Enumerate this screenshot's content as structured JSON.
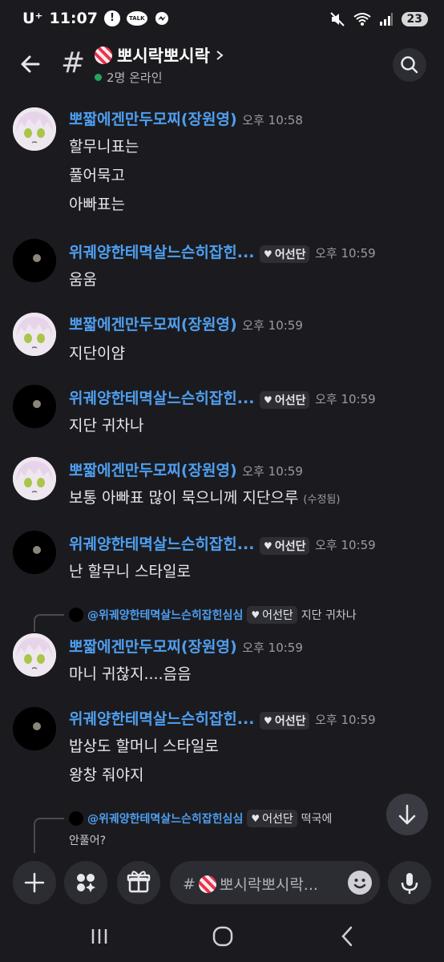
{
  "status": {
    "carrier": "U⁺",
    "time": "11:07",
    "battery": "23"
  },
  "channel": {
    "title": "뽀시락뽀시락",
    "online": "2명 온라인",
    "input_placeholder": "뽀시락뽀시락..."
  },
  "messages": [
    {
      "user": "뽀짧에겐만두모찌(장원영)",
      "time": "오후 10:58",
      "lines": [
        "할무니표는",
        "풀어묵고",
        "아빠표는"
      ]
    },
    {
      "user": "위궤양한테멱살느슨히잡힌...",
      "tag": "어선단",
      "time": "오후 10:59",
      "lines": [
        "움움"
      ]
    },
    {
      "user": "뽀짧에겐만두모찌(장원영)",
      "time": "오후 10:59",
      "lines": [
        "지단이얌"
      ]
    },
    {
      "user": "위궤양한테멱살느슨히잡힌...",
      "tag": "어선단",
      "time": "오후 10:59",
      "lines": [
        "지단 귀차나"
      ]
    },
    {
      "user": "뽀짧에겐만두모찌(장원영)",
      "time": "오후 10:59",
      "lines": [
        "보통 아빠표 많이 묵으니께 지단으루"
      ],
      "edited": "(수정됨)"
    },
    {
      "user": "위궤양한테멱살느슨히잡힌...",
      "tag": "어선단",
      "time": "오후 10:59",
      "lines": [
        "난 할무니 스타일로"
      ]
    },
    {
      "reply": {
        "name": "@위궤양한테멱살느슨히잡힌심심",
        "tag": "어선단",
        "text": "지단 귀차나"
      },
      "user": "뽀짧에겐만두모찌(장원영)",
      "time": "오후 10:59",
      "lines": [
        "마니 귀찮지....음음"
      ]
    },
    {
      "user": "위궤양한테멱살느슨히잡힌...",
      "tag": "어선단",
      "time": "오후 10:59",
      "lines": [
        "밥상도 할머니 스타일로",
        "왕창 줘야지"
      ]
    },
    {
      "reply": {
        "name": "@위궤양한테멱살느슨히잡힌심심",
        "tag": "어선단",
        "text": "떡국에"
      },
      "lines": [
        "안풀어?"
      ]
    }
  ],
  "icons": {
    "back": "arrow-left-icon",
    "search": "search-icon",
    "plus": "plus-icon",
    "apps": "apps-icon",
    "gift": "gift-icon",
    "emoji": "emoji-icon",
    "mic": "mic-icon",
    "scroll": "arrow-down-icon"
  },
  "colors": {
    "background": "#1b1b1f",
    "username": "#4e9ff0",
    "online": "#23a55a"
  }
}
